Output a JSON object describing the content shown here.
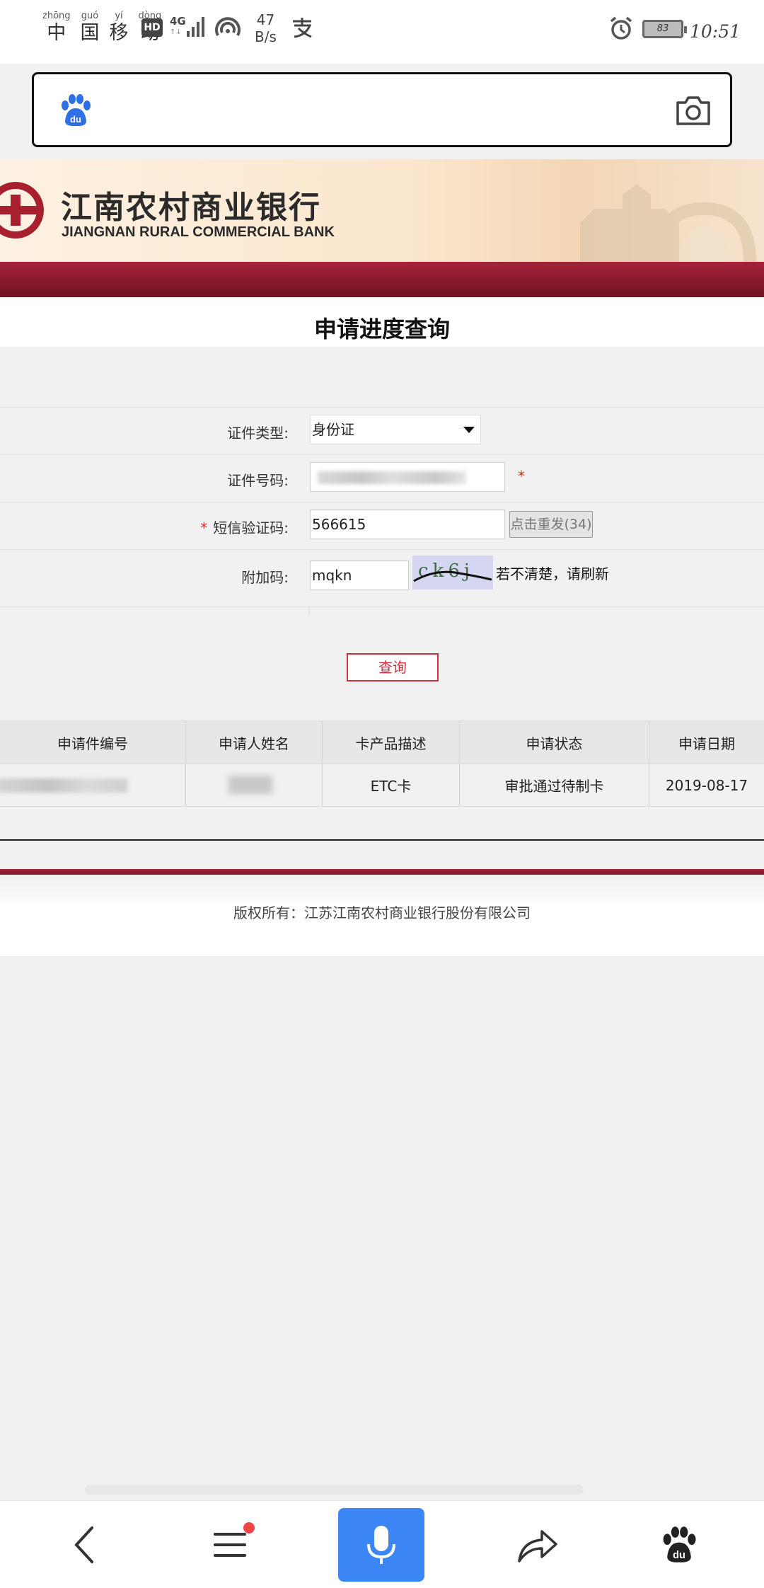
{
  "status_bar": {
    "carrier": [
      {
        "pinyin": "zhōng",
        "char": "中"
      },
      {
        "pinyin": "guó",
        "char": "国"
      },
      {
        "pinyin": "yí",
        "char": "移"
      },
      {
        "pinyin": "dòng",
        "char": "动"
      }
    ],
    "hd": "HD",
    "network": "4G",
    "speed_value": "47",
    "speed_unit": "B/s",
    "battery": "83",
    "time": "10:51"
  },
  "bank": {
    "name_cn": "江南农村商业银行",
    "name_en": "JIANGNAN RURAL COMMERCIAL BANK"
  },
  "page_title": "申请进度查询",
  "form": {
    "id_type": {
      "label": "证件类型:",
      "value": "身份证"
    },
    "id_number": {
      "label": "证件号码:",
      "required_mark": "*"
    },
    "sms_code": {
      "required_mark": "*",
      "label": "短信验证码:",
      "value": "566615",
      "resend_label": "点击重发(34)"
    },
    "extra_code": {
      "label": "附加码:",
      "value": "mqkn",
      "captcha_text": "ck6j",
      "hint": "若不清楚，请刷新"
    }
  },
  "query_button": "查询",
  "results": {
    "headers": [
      "申请件编号",
      "申请人姓名",
      "卡产品描述",
      "申请状态",
      "申请日期"
    ],
    "rows": [
      {
        "product": "ETC卡",
        "status": "审批通过待制卡",
        "date": "2019-08-17"
      }
    ]
  },
  "footer": {
    "copyright": "版权所有：江苏江南农村商业银行股份有限公司"
  },
  "colors": {
    "brand_red": "#8b1a2e",
    "accent_blue": "#3b85f5",
    "button_red": "#c9353e"
  }
}
